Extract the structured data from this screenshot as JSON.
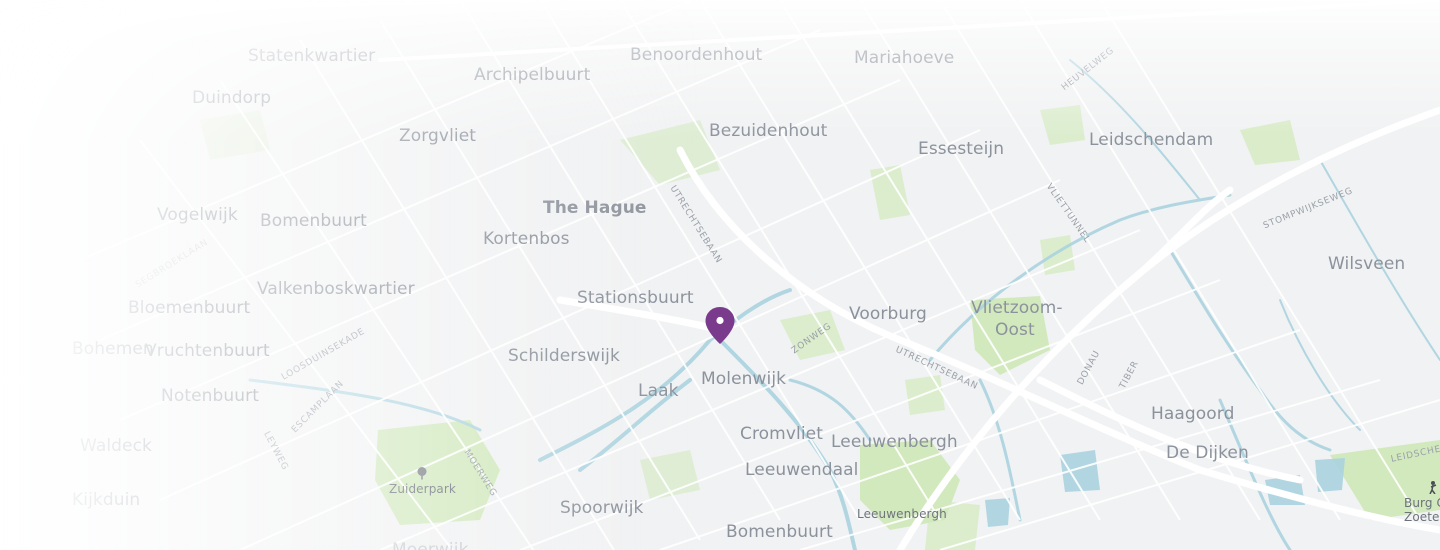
{
  "map": {
    "colors": {
      "land": "#f1f2f3",
      "road": "#ffffff",
      "water": "#aad3df",
      "park": "#cde8b5",
      "pin": "#7b3b8c",
      "label": "#8a8f99"
    },
    "marker": {
      "icon": "map-pin-icon",
      "color": "#7b3b8c"
    },
    "labels": {
      "area": [
        "Statenkwartier",
        "Archipelbuurt",
        "Duindorp",
        "Benoordenhout",
        "Mariahoeve",
        "Zorgvliet",
        "Bezuidenhout",
        "Essesteijn",
        "Leidschendam",
        "Vogelwijk",
        "Bomenbuurt",
        "Kortenbos",
        "Wilsveen",
        "Valkenboskwartier",
        "Bloemenbuurt",
        "Stationsbuurt",
        "Voorburg",
        "Vlietzoom-",
        "Oost",
        "Vruchtenbuurt",
        "Schilderswijk",
        "Molenwijk",
        "Laak",
        "Notenbuurt",
        "Haagoord",
        "Cromvliet",
        "Leeuwenbergh",
        "De Dijken",
        "Leeuwendaal",
        "Spoorwijk",
        "Bomenbuurt",
        "Bohemen",
        "Waldeck",
        "Kijkduin",
        "Moerwijk"
      ],
      "city": "The Hague",
      "small": "Leeuwenbergh",
      "roads": [
        "UTRECHTSEBAAN",
        "HEUVELWEG",
        "VLIETTUNNEL",
        "STOMPWIJKSEWEG",
        "SEGBROEKLAAN",
        "ZONWEG",
        "UTRECHTSEBAAN",
        "LOOSDUINSEKADE",
        "ESCAMPLAAN",
        "DONAU",
        "TIBER",
        "LEYWEG",
        "MOERWEG",
        "LEIDSCHENDAMMERWEG"
      ],
      "poi": [
        {
          "name": "Zuiderpark",
          "icon": "tree-icon"
        },
        {
          "name": "Burg C",
          "name2": "Zoeterm",
          "icon": "golf-icon"
        }
      ]
    }
  }
}
